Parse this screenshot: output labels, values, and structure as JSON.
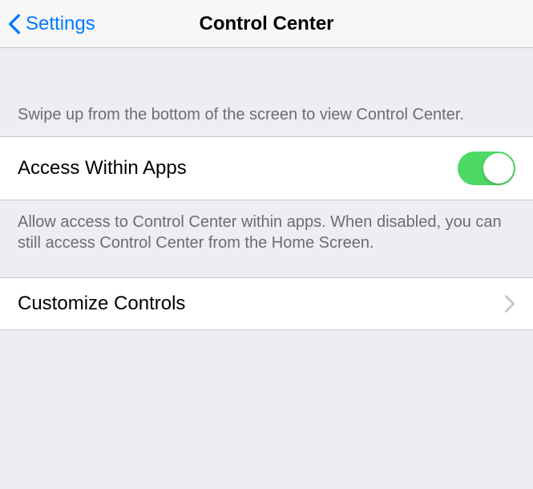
{
  "nav": {
    "back_label": "Settings",
    "title": "Control Center"
  },
  "intro_text": "Swipe up from the bottom of the screen to view Control Center.",
  "access_row": {
    "label": "Access Within Apps",
    "footer": "Allow access to Control Center within apps. When disabled, you can still access Control Center from the Home Screen.",
    "enabled": true
  },
  "customize_row": {
    "label": "Customize Controls"
  }
}
